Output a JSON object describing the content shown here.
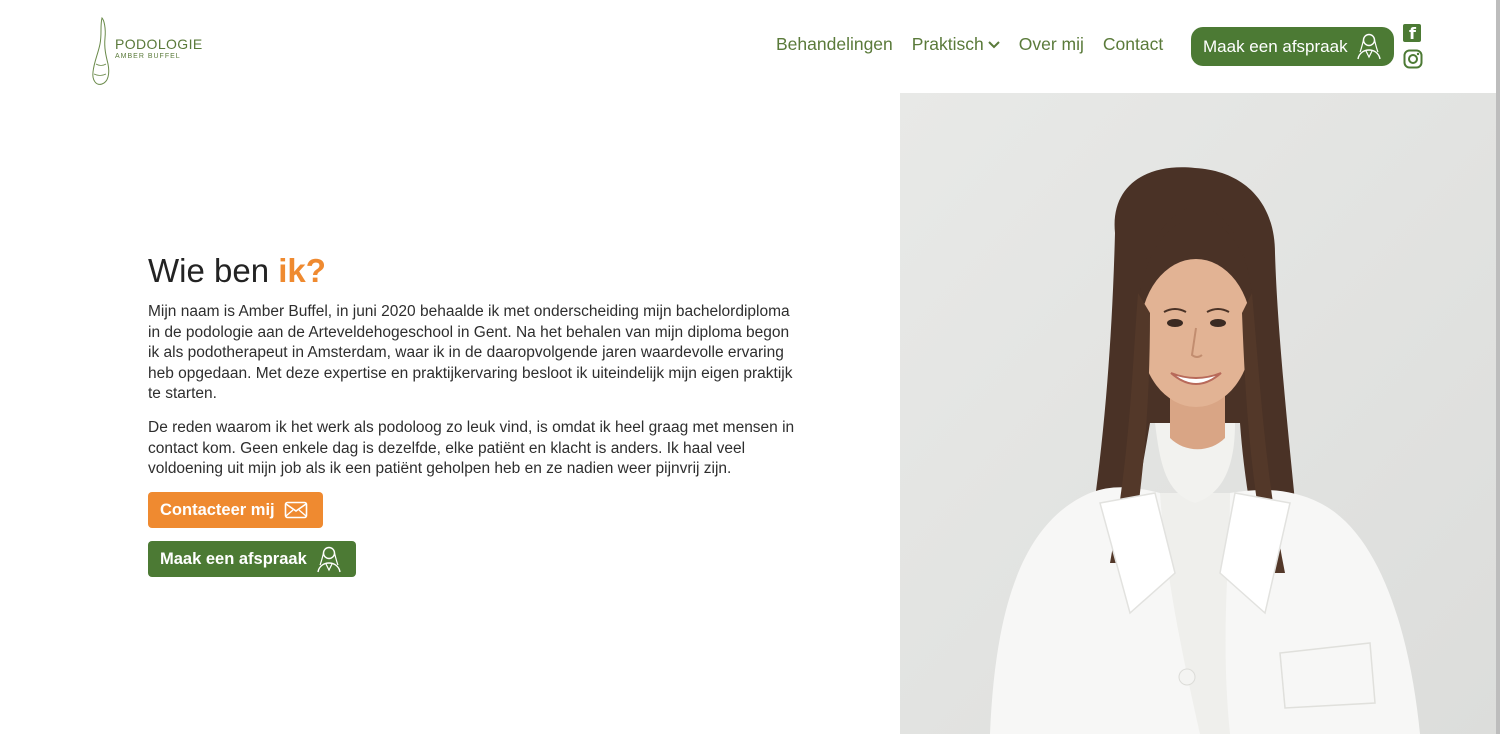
{
  "header": {
    "logo": {
      "brand": "PODOLOGIE",
      "sub": "AMBER BUFFEL"
    },
    "nav": [
      {
        "label": "Behandelingen"
      },
      {
        "label": "Praktisch"
      },
      {
        "label": "Over mij"
      },
      {
        "label": "Contact"
      }
    ],
    "cta_label": "Maak een afspraak",
    "social": [
      "facebook-icon",
      "instagram-icon"
    ]
  },
  "about": {
    "heading_main": "Wie ben ",
    "heading_accent": "ik?",
    "paragraph_1": "Mijn naam is Amber Buffel, in juni 2020 behaalde ik met onderscheiding mijn bachelordiploma in de podologie aan de Arteveldehogeschool in Gent. Na het behalen van mijn diploma begon ik als podotherapeut in Amsterdam, waar ik in de daaropvolgende jaren waardevolle ervaring heb opgedaan. Met deze expertise en praktijkervaring besloot ik uiteindelijk mijn eigen praktijk te starten.",
    "paragraph_2": "De reden waarom ik het werk als podoloog zo leuk vind, is omdat ik heel graag met mensen in contact kom. Geen enkele dag is dezelfde, elke patiënt en klacht is anders. Ik haal veel voldoening uit mijn job als ik een patiënt geholpen heb en ze nadien weer pijnvrij zijn.",
    "contact_button": "Contacteer mij",
    "appointment_button": "Maak een afspraak"
  },
  "colors": {
    "green": "#4c7a34",
    "orange": "#ef8a30",
    "photo_bg": "#e3e4e2"
  }
}
